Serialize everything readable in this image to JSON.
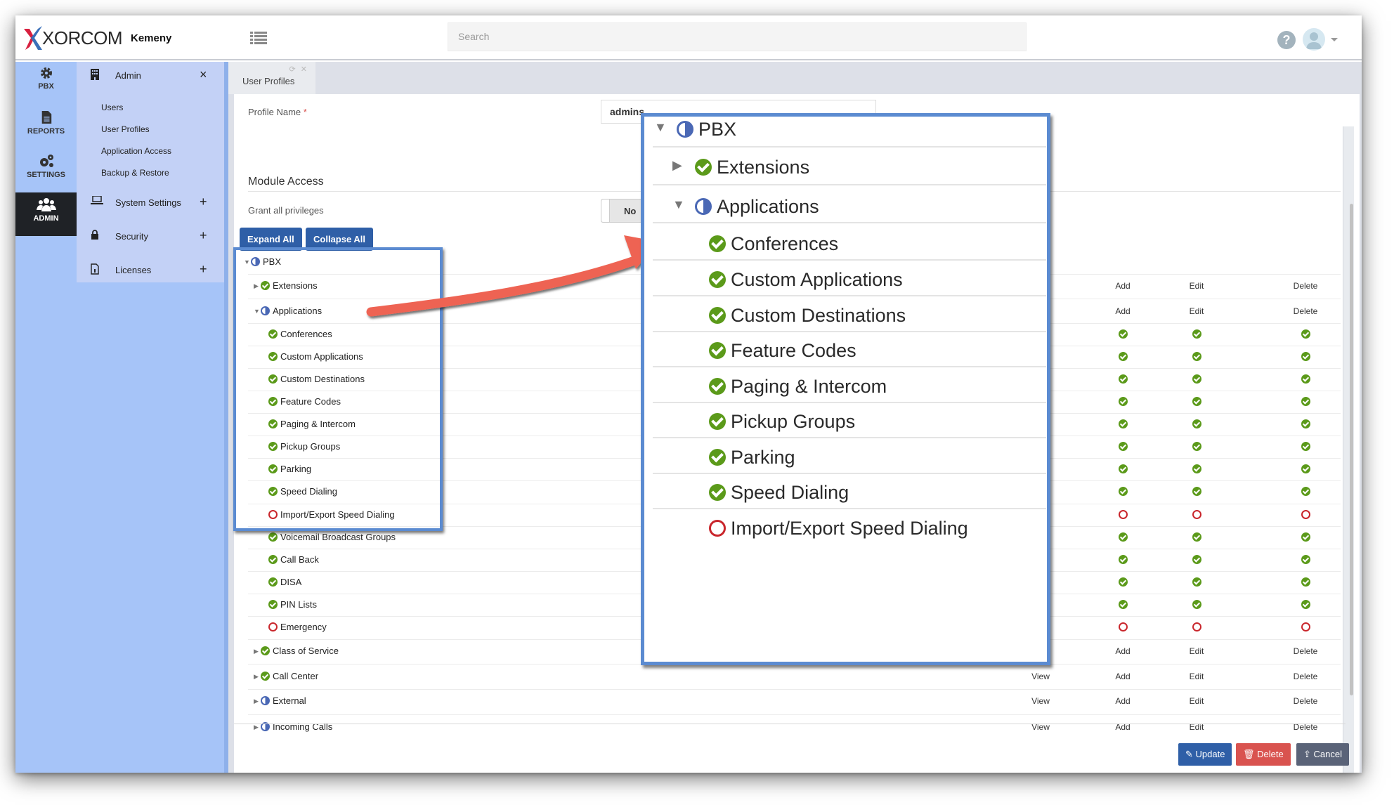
{
  "app": {
    "brand": "XORCOM",
    "brand_sub": "Kemeny"
  },
  "header": {
    "search_placeholder": "Search",
    "help_label": "?"
  },
  "rail": [
    {
      "label": "PBX",
      "icon": "gear-icon"
    },
    {
      "label": "REPORTS",
      "icon": "document-icon"
    },
    {
      "label": "SETTINGS",
      "icon": "gears-icon"
    },
    {
      "label": "ADMIN",
      "icon": "users-icon",
      "active": true
    }
  ],
  "subnav": {
    "admin": {
      "label": "Admin",
      "action": "×",
      "items": [
        "Users",
        "User Profiles",
        "Application Access",
        "Backup & Restore"
      ]
    },
    "system_settings": {
      "label": "System Settings",
      "action": "+"
    },
    "security": {
      "label": "Security",
      "action": "+"
    },
    "licenses": {
      "label": "Licenses",
      "action": "+"
    }
  },
  "tab": {
    "label": "User Profiles",
    "icons": "⟳ ✕"
  },
  "form": {
    "profile_name_label": "Profile Name",
    "required_mark": "*",
    "profile_name_value": "admins",
    "module_access_title": "Module Access",
    "grant_all_label": "Grant all privileges",
    "grant_all_value": "No",
    "expand_all": "Expand All",
    "collapse_all": "Collapse All"
  },
  "tree": [
    {
      "label": "PBX",
      "level": 0,
      "expander": "open",
      "status": "partial",
      "cols": [
        "",
        "",
        "",
        ""
      ]
    },
    {
      "label": "Extensions",
      "level": 1,
      "expander": "closed",
      "status": "full",
      "cols": [
        "",
        "Add",
        "Edit",
        "Delete"
      ]
    },
    {
      "label": "Applications",
      "level": 1,
      "expander": "open",
      "status": "partial",
      "cols": [
        "",
        "Add",
        "Edit",
        "Delete"
      ]
    },
    {
      "label": "Conferences",
      "level": 2,
      "status": "full",
      "cols": [
        "",
        "full",
        "full",
        "full"
      ]
    },
    {
      "label": "Custom Applications",
      "level": 2,
      "status": "full",
      "cols": [
        "",
        "full",
        "full",
        "full"
      ]
    },
    {
      "label": "Custom Destinations",
      "level": 2,
      "status": "full",
      "cols": [
        "",
        "full",
        "full",
        "full"
      ]
    },
    {
      "label": "Feature Codes",
      "level": 2,
      "status": "full",
      "cols": [
        "",
        "full",
        "full",
        "full"
      ]
    },
    {
      "label": "Paging & Intercom",
      "level": 2,
      "status": "full",
      "cols": [
        "",
        "full",
        "full",
        "full"
      ]
    },
    {
      "label": "Pickup Groups",
      "level": 2,
      "status": "full",
      "cols": [
        "",
        "full",
        "full",
        "full"
      ]
    },
    {
      "label": "Parking",
      "level": 2,
      "status": "full",
      "cols": [
        "",
        "full",
        "full",
        "full"
      ]
    },
    {
      "label": "Speed Dialing",
      "level": 2,
      "status": "full",
      "cols": [
        "",
        "full",
        "full",
        "full"
      ]
    },
    {
      "label": "Import/Export Speed Dialing",
      "level": 2,
      "status": "none",
      "cols": [
        "",
        "none",
        "none",
        "none"
      ]
    },
    {
      "label": "Voicemail Broadcast Groups",
      "level": 2,
      "status": "full",
      "cols": [
        "",
        "full",
        "full",
        "full"
      ]
    },
    {
      "label": "Call Back",
      "level": 2,
      "status": "full",
      "cols": [
        "",
        "full",
        "full",
        "full"
      ]
    },
    {
      "label": "DISA",
      "level": 2,
      "status": "full",
      "cols": [
        "",
        "full",
        "full",
        "full"
      ]
    },
    {
      "label": "PIN Lists",
      "level": 2,
      "status": "full",
      "cols": [
        "",
        "full",
        "full",
        "full"
      ]
    },
    {
      "label": "Emergency",
      "level": 2,
      "status": "none",
      "cols": [
        "",
        "none",
        "none",
        "none"
      ]
    },
    {
      "label": "Class of Service",
      "level": 1,
      "expander": "closed",
      "status": "full",
      "cols": [
        "",
        "Add",
        "Edit",
        "Delete"
      ]
    },
    {
      "label": "Call Center",
      "level": 1,
      "expander": "closed",
      "status": "full",
      "cols": [
        "View",
        "Add",
        "Edit",
        "Delete"
      ]
    },
    {
      "label": "External",
      "level": 1,
      "expander": "closed",
      "status": "partial",
      "cols": [
        "View",
        "Add",
        "Edit",
        "Delete"
      ]
    },
    {
      "label": "Incoming Calls",
      "level": 1,
      "expander": "closed",
      "status": "partial",
      "cols": [
        "View",
        "Add",
        "Edit",
        "Delete"
      ]
    }
  ],
  "callout": [
    {
      "label": "PBX",
      "level": 0,
      "expander": "open",
      "status": "partial"
    },
    {
      "label": "Extensions",
      "level": 1,
      "expander": "closed",
      "status": "full"
    },
    {
      "label": "Applications",
      "level": 1,
      "expander": "open",
      "status": "partial"
    },
    {
      "label": "Conferences",
      "level": 2,
      "status": "full"
    },
    {
      "label": "Custom Applications",
      "level": 2,
      "status": "full"
    },
    {
      "label": "Custom Destinations",
      "level": 2,
      "status": "full"
    },
    {
      "label": "Feature Codes",
      "level": 2,
      "status": "full"
    },
    {
      "label": "Paging & Intercom",
      "level": 2,
      "status": "full"
    },
    {
      "label": "Pickup Groups",
      "level": 2,
      "status": "full"
    },
    {
      "label": "Parking",
      "level": 2,
      "status": "full"
    },
    {
      "label": "Speed Dialing",
      "level": 2,
      "status": "full"
    },
    {
      "label": "Import/Export Speed Dialing",
      "level": 2,
      "status": "none"
    }
  ],
  "footer": {
    "update": "Update",
    "delete": "Delete",
    "cancel": "Cancel"
  },
  "colors": {
    "primary": "#2f5fa7",
    "danger": "#d9534f",
    "neutral": "#5a6378",
    "check": "#5b9a1a",
    "none": "#c9262c",
    "partial": "#4a68b5",
    "annotation_arrow": "#ee6352",
    "annotation_box": "#5b8bd1"
  }
}
